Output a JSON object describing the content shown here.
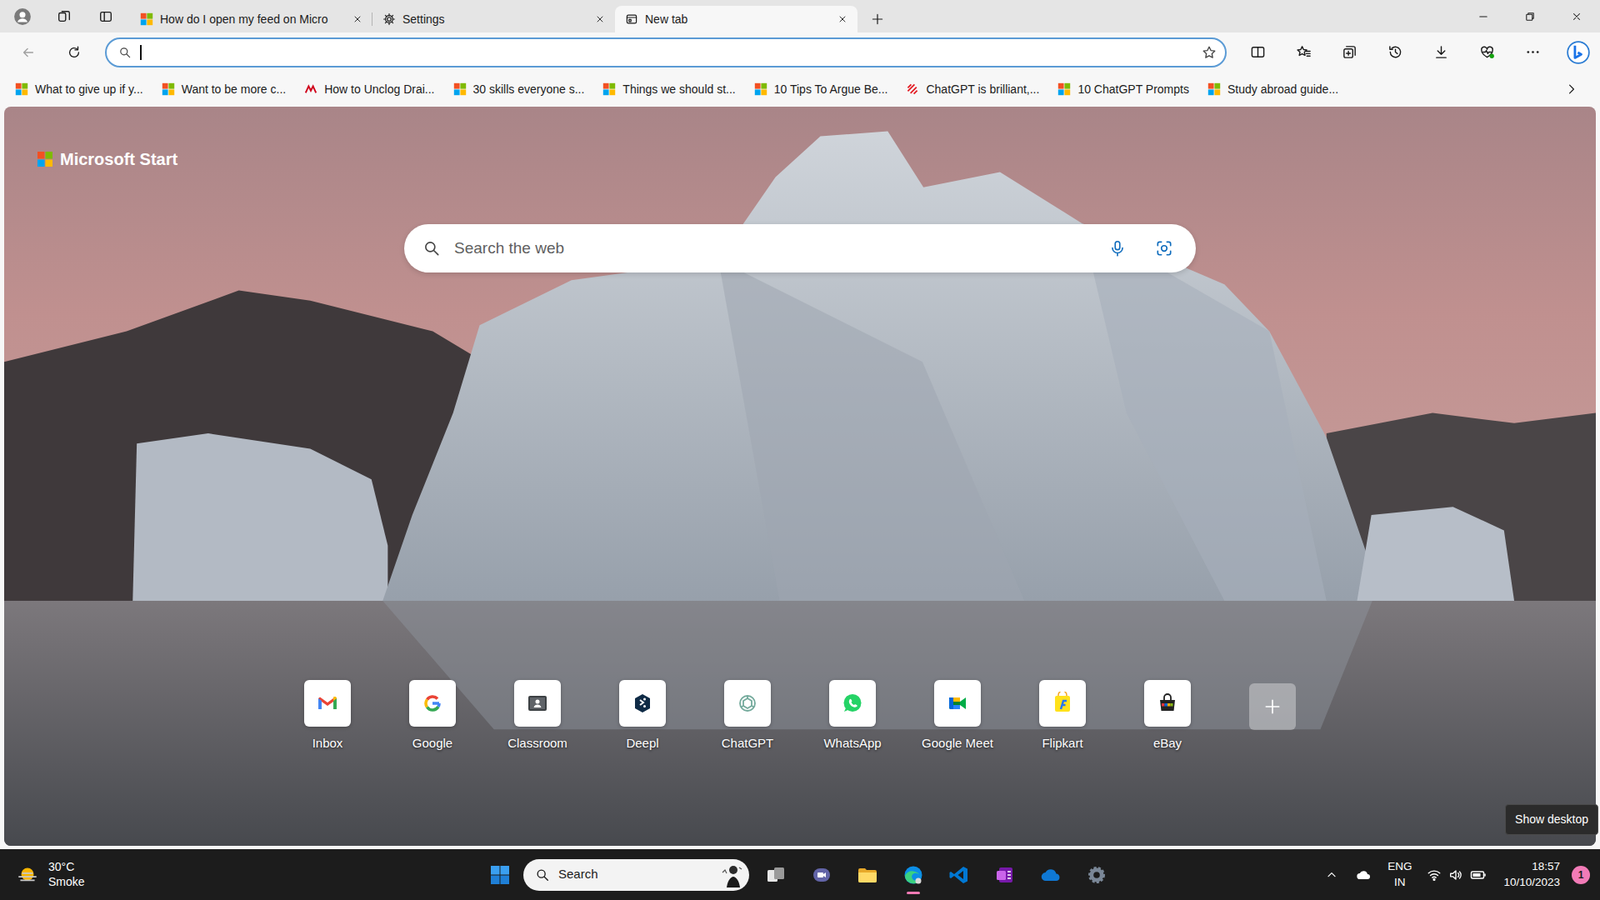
{
  "tabs": [
    {
      "label": "How do I open my feed on Micro",
      "selected": false
    },
    {
      "label": "Settings",
      "selected": false
    },
    {
      "label": "New tab",
      "selected": true
    }
  ],
  "address_bar": {
    "focused": true
  },
  "favorites_bar": {
    "items": [
      {
        "label": "What to give up if y..."
      },
      {
        "label": "Want to be more c..."
      },
      {
        "label": "How to Unclog Drai..."
      },
      {
        "label": "30 skills everyone s..."
      },
      {
        "label": "Things we should st..."
      },
      {
        "label": "10 Tips To Argue Be..."
      },
      {
        "label": "ChatGPT is brilliant,..."
      },
      {
        "label": "10 ChatGPT Prompts"
      },
      {
        "label": "Study abroad guide..."
      }
    ]
  },
  "start_page": {
    "brand": "Microsoft Start",
    "search": {
      "placeholder": "Search the web"
    },
    "quick_links": [
      {
        "label": "Inbox"
      },
      {
        "label": "Google"
      },
      {
        "label": "Classroom"
      },
      {
        "label": "Deepl"
      },
      {
        "label": "ChatGPT"
      },
      {
        "label": "WhatsApp"
      },
      {
        "label": "Google Meet"
      },
      {
        "label": "Flipkart"
      },
      {
        "label": "eBay"
      }
    ]
  },
  "tooltip": {
    "text": "Show desktop"
  },
  "taskbar": {
    "weather": {
      "temperature": "30°C",
      "condition": "Smoke"
    },
    "search": {
      "placeholder": "Search"
    },
    "apps": [
      {
        "active": false
      },
      {
        "active": false
      },
      {
        "active": false
      },
      {
        "active": true
      },
      {
        "active": false
      },
      {
        "active": false
      },
      {
        "active": false
      },
      {
        "active": false
      }
    ],
    "tray": {
      "language": "ENG",
      "region": "IN",
      "time": "18:57",
      "date": "10/10/2023",
      "notifications": "1"
    }
  }
}
